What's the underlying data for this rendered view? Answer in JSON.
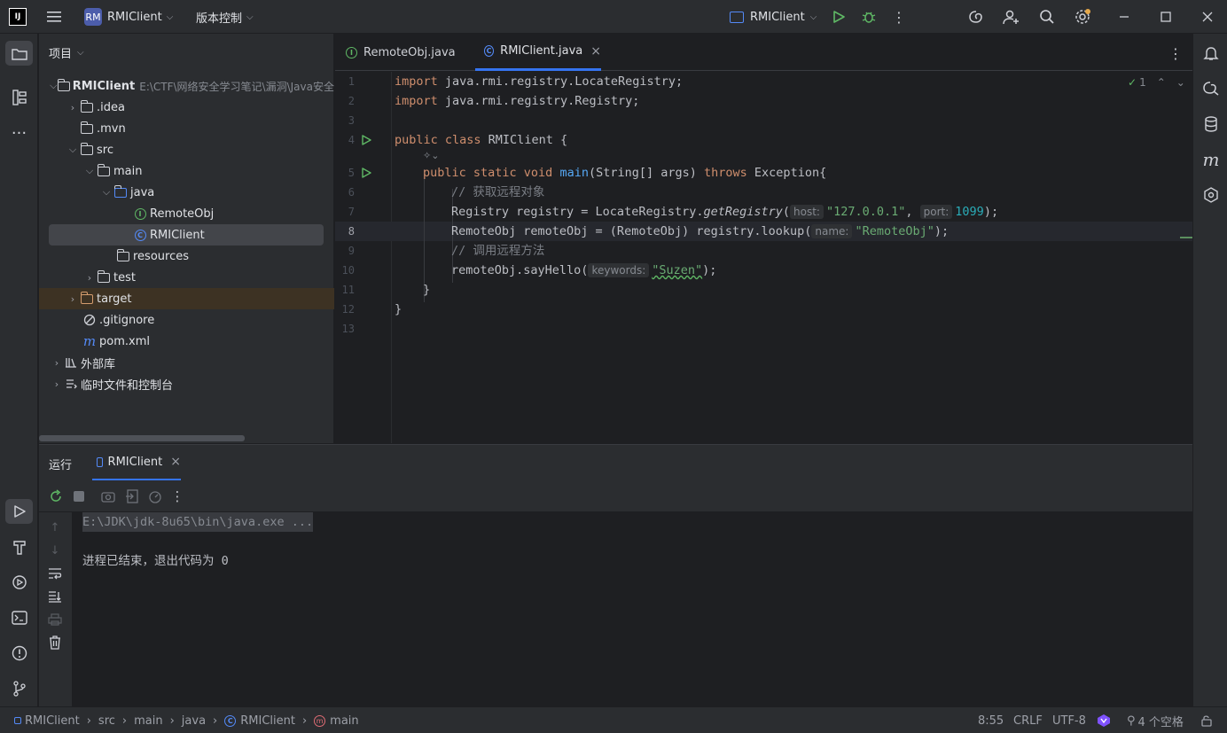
{
  "titlebar": {
    "project_badge": "RM",
    "project_name": "RMIClient",
    "vcs_menu": "版本控制",
    "run_config": "RMIClient"
  },
  "project_panel": {
    "title": "项目",
    "root_name": "RMIClient",
    "root_path": "E:\\CTF\\网络安全学习笔记\\漏洞\\Java安全",
    "items": {
      "idea": ".idea",
      "mvn": ".mvn",
      "src": "src",
      "main": "main",
      "java": "java",
      "remoteobj": "RemoteObj",
      "rmiclient": "RMIClient",
      "resources": "resources",
      "test": "test",
      "target": "target",
      "gitignore": ".gitignore",
      "pom": "pom.xml",
      "external_libs": "外部库",
      "scratches": "临时文件和控制台"
    }
  },
  "editor": {
    "tabs": [
      {
        "label": "RemoteObj.java"
      },
      {
        "label": "RMIClient.java"
      }
    ],
    "inspection_count": "1",
    "lines": {
      "l1_kw": "import",
      "l1_rest": " java.rmi.registry.LocateRegistry;",
      "l2_kw": "import",
      "l2_rest": " java.rmi.registry.Registry;",
      "l4_kw": "public class",
      "l4_rest": " RMIClient {",
      "l5_kw1": "public static void",
      "l5_fn": "main",
      "l5_mid": "(String[] args) ",
      "l5_kw2": "throws",
      "l5_rest": " Exception{",
      "l6_cmt": "// 获取远程对象",
      "l7_a": "Registry registry = LocateRegistry.",
      "l7_fn": "getRegistry",
      "l7_hint1": "host:",
      "l7_str": "\"127.0.0.1\"",
      "l7_comma": ", ",
      "l7_hint2": "port:",
      "l7_num": "1099",
      "l7_end": ");",
      "l8_a": "RemoteObj remoteObj = (RemoteObj) registry.lookup(",
      "l8_hint": "name:",
      "l8_str": "\"RemoteObj\"",
      "l8_end": ");",
      "l9_cmt": "// 调用远程方法",
      "l10_a": "remoteObj.sayHello(",
      "l10_hint": "keywords:",
      "l10_str": "\"Suzen\"",
      "l10_end": ");",
      "l11": "}",
      "l12": "}"
    },
    "line_numbers": [
      "1",
      "2",
      "3",
      "4",
      "5",
      "6",
      "7",
      "8",
      "9",
      "10",
      "11",
      "12",
      "13"
    ]
  },
  "run_panel": {
    "title": "运行",
    "tab_label": "RMIClient",
    "command": "E:\\JDK\\jdk-8u65\\bin\\java.exe ...",
    "exit_message": "进程已结束，退出代码为 0"
  },
  "statusbar": {
    "crumbs": [
      "RMIClient",
      "src",
      "main",
      "java",
      "RMIClient",
      "main"
    ],
    "position": "8:55",
    "line_sep": "CRLF",
    "encoding": "UTF-8",
    "indent": "4 个空格"
  }
}
